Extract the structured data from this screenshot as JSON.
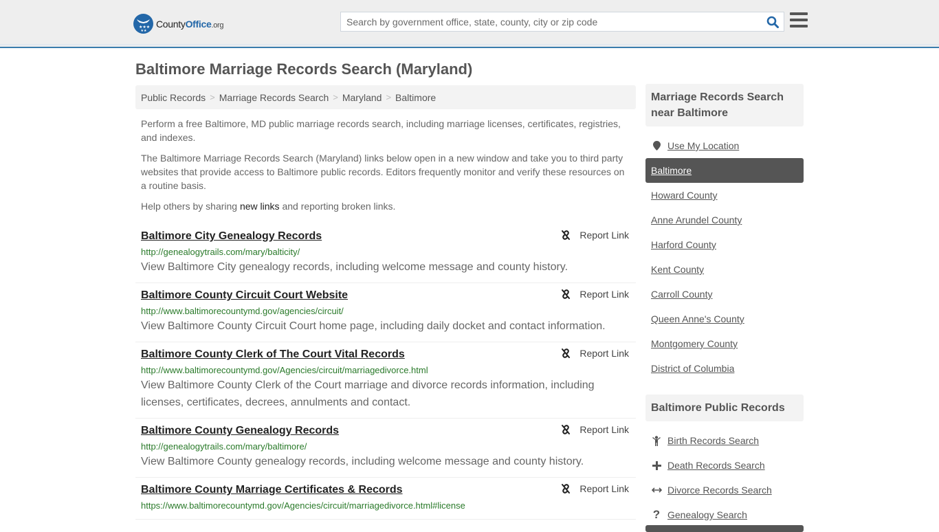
{
  "header": {
    "logo_text_main": "County",
    "logo_text_accent": "Office",
    "logo_text_tld": ".org",
    "search_placeholder": "Search by government office, state, county, city or zip code",
    "search_icon": "search-icon",
    "menu_icon": "hamburger-menu-icon"
  },
  "colors": {
    "brand_blue": "#2367a8",
    "header_border": "#3a7cad",
    "url_green": "#2a7a2a",
    "active_bg": "#555555"
  },
  "page": {
    "title": "Baltimore Marriage Records Search (Maryland)"
  },
  "breadcrumb": [
    {
      "label": "Public Records"
    },
    {
      "label": "Marriage Records Search"
    },
    {
      "label": "Maryland"
    },
    {
      "label": "Baltimore"
    }
  ],
  "breadcrumb_separator": ">",
  "intro": {
    "p1": "Perform a free Baltimore, MD public marriage records search, including marriage licenses, certificates, registries, and indexes.",
    "p2": "The Baltimore Marriage Records Search (Maryland) links below open in a new window and take you to third party websites that provide access to Baltimore public records. Editors frequently monitor and verify these resources on a routine basis.",
    "p3_before": "Help others by sharing ",
    "p3_link": "new links",
    "p3_after": " and reporting broken links."
  },
  "report_label": "Report Link",
  "results": [
    {
      "title": "Baltimore City Genealogy Records",
      "url": "http://genealogytrails.com/mary/balticity/",
      "desc": "View Baltimore City genealogy records, including welcome message and county history."
    },
    {
      "title": "Baltimore County Circuit Court Website",
      "url": "http://www.baltimorecountymd.gov/agencies/circuit/",
      "desc": "View Baltimore County Circuit Court home page, including daily docket and contact information."
    },
    {
      "title": "Baltimore County Clerk of The Court Vital Records",
      "url": "http://www.baltimorecountymd.gov/Agencies/circuit/marriagedivorce.html",
      "desc": "View Baltimore County Clerk of the Court marriage and divorce records information, including licenses, certificates, decrees, annulments and contact."
    },
    {
      "title": "Baltimore County Genealogy Records",
      "url": "http://genealogytrails.com/mary/baltimore/",
      "desc": "View Baltimore County genealogy records, including welcome message and county history."
    },
    {
      "title": "Baltimore County Marriage Certificates & Records",
      "url": "https://www.baltimorecountymd.gov/Agencies/circuit/marriagedivorce.html#license",
      "desc": ""
    }
  ],
  "sidebar": {
    "nearby_heading": "Marriage Records Search near Baltimore",
    "use_location": "Use My Location",
    "nearby": [
      {
        "label": "Baltimore",
        "active": true
      },
      {
        "label": "Howard County"
      },
      {
        "label": "Anne Arundel County"
      },
      {
        "label": "Harford County"
      },
      {
        "label": "Kent County"
      },
      {
        "label": "Carroll County"
      },
      {
        "label": "Queen Anne's County"
      },
      {
        "label": "Montgomery County"
      },
      {
        "label": "District of Columbia"
      }
    ],
    "public_heading": "Baltimore Public Records",
    "public": [
      {
        "label": "Birth Records Search",
        "icon": "child-icon"
      },
      {
        "label": "Death Records Search",
        "icon": "plus-icon"
      },
      {
        "label": "Divorce Records Search",
        "icon": "arrows-horizontal-icon"
      },
      {
        "label": "Genealogy Search",
        "icon": "question-icon"
      }
    ]
  }
}
